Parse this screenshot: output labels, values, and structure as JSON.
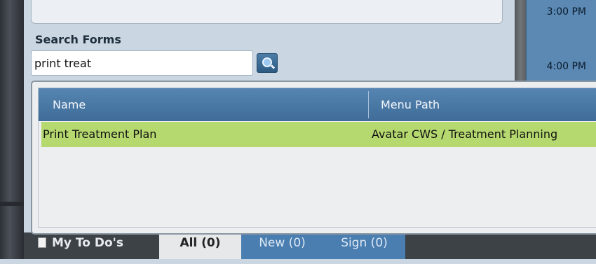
{
  "search": {
    "label": "Search Forms",
    "query": "print treat",
    "button_icon": "magnifier-icon"
  },
  "calendar": {
    "times": [
      "3:00 PM",
      "4:00 PM"
    ]
  },
  "results": {
    "columns": [
      "Name",
      "Menu Path"
    ],
    "rows": [
      {
        "name": "Print Treatment Plan",
        "menu_path": "Avatar CWS / Treatment Planning",
        "highlight": "#b5d86f"
      }
    ]
  },
  "tabs": {
    "todo": "My To Do's",
    "all": "All (0)",
    "new": "New (0)",
    "sign": "Sign (0)"
  },
  "colors": {
    "header": "#4a7aa8",
    "selected_row": "#b5d86f",
    "panel": "#cad6e2"
  }
}
